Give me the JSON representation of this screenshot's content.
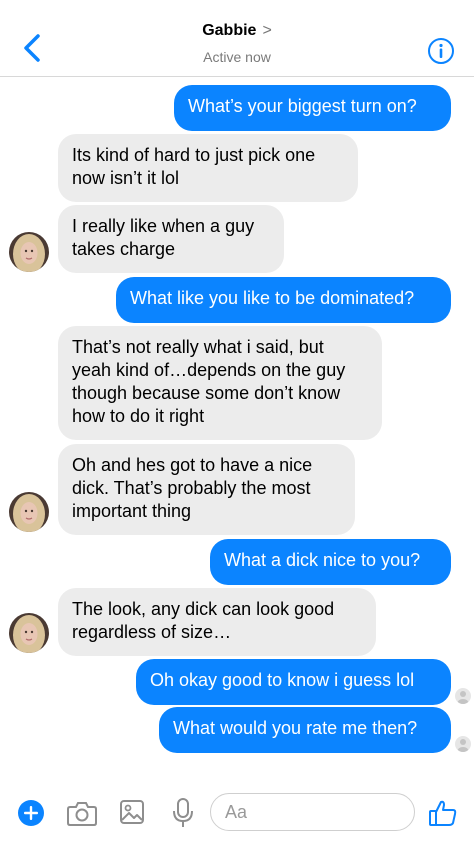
{
  "header": {
    "contact_name": "Gabbie",
    "name_chevron": ">",
    "status": "Active now"
  },
  "messages": [
    {
      "from": "me",
      "text": "What’s your biggest turn on?"
    },
    {
      "from": "them",
      "lines": [
        "Its kind of hard to just pick one",
        "now isn’t it lol"
      ]
    },
    {
      "from": "them",
      "lines": [
        "I really like when a guy",
        "takes charge"
      ]
    },
    {
      "from": "me",
      "text": "What like you like to be dominated?"
    },
    {
      "from": "them",
      "lines": [
        "That’s not really what i said, but",
        "yeah kind of…depends on the guy",
        "though because some don’t know",
        "how to do it right"
      ]
    },
    {
      "from": "them",
      "lines": [
        "Oh and hes got to have a nice",
        "dick. That’s probably the most",
        "important thing"
      ]
    },
    {
      "from": "me",
      "text": "What a dick nice to you?"
    },
    {
      "from": "them",
      "lines": [
        "The look, any dick can look good",
        "regardless of size…"
      ]
    },
    {
      "from": "me",
      "text": "Oh okay good to know i guess lol"
    },
    {
      "from": "me",
      "text": "What would you rate me then?"
    }
  ],
  "composer": {
    "placeholder": "Aa"
  },
  "colors": {
    "accent": "#0b84ff",
    "incoming_bubble": "#ececec"
  },
  "icons": [
    "back-chevron-icon",
    "info-icon",
    "plus-icon",
    "camera-icon",
    "photo-icon",
    "microphone-icon",
    "thumbs-up-icon"
  ]
}
